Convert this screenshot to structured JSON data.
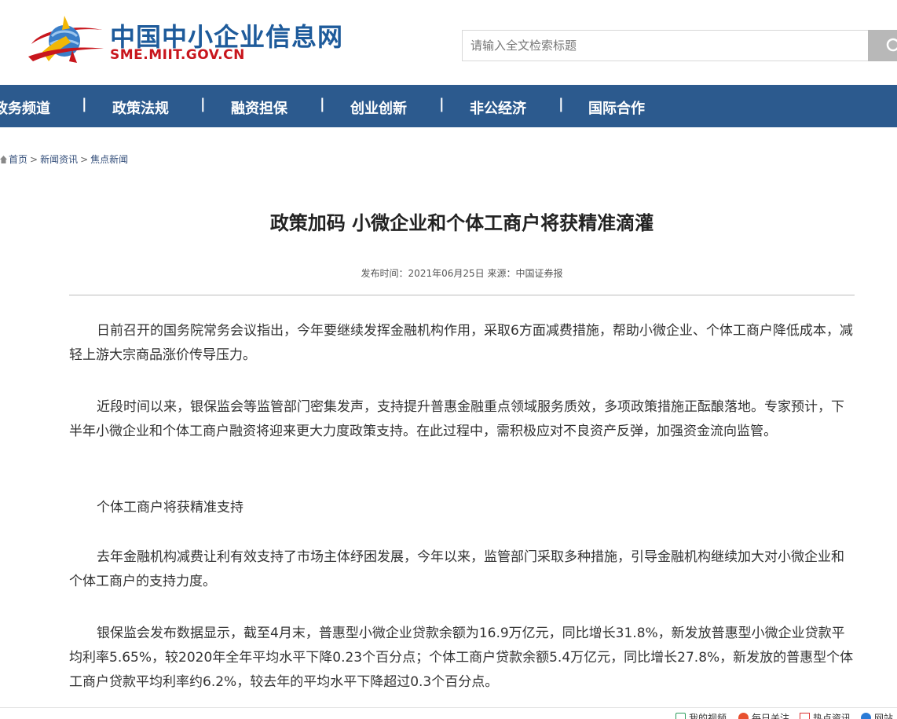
{
  "header": {
    "site_name": "中国中小企业信息网",
    "site_url": "SME.MIIT.GOV.CN",
    "search_placeholder": "请输入全文检索标题",
    "brand_blue": "#1e5b9b",
    "brand_red": "#c8161d"
  },
  "nav": {
    "background": "#2c5a8e",
    "items": [
      "政务频道",
      "政策法规",
      "融资担保",
      "创业创新",
      "非公经济",
      "国际合作"
    ],
    "separator": "|"
  },
  "breadcrumb": {
    "items": [
      "首页",
      "新闻资讯",
      "焦点新闻"
    ],
    "separator": ">"
  },
  "article": {
    "title": "政策加码 小微企业和个体工商户将获精准滴灌",
    "meta": "发布时间：2021年06月25日 来源：中国证券报",
    "paragraphs": [
      "日前召开的国务院常务会议指出，今年要继续发挥金融机构作用，采取6方面减费措施，帮助小微企业、个体工商户降低成本，减轻上游大宗商品涨价传导压力。",
      "近段时间以来，银保监会等监管部门密集发声，支持提升普惠金融重点领域服务质效，多项政策措施正酝酿落地。专家预计，下半年小微企业和个体工商户融资将迎来更大力度政策支持。在此过程中，需积极应对不良资产反弹，加强资金流向监管。",
      "个体工商户将获精准支持",
      "去年金融机构减费让利有效支持了市场主体纾困发展，今年以来，监管部门采取多种措施，引导金融机构继续加大对小微企业和个体工商户的支持力度。",
      "银保监会发布数据显示，截至4月末，普惠型小微企业贷款余额为16.9万亿元，同比增长31.8%，新发放普惠型小微企业贷款平均利率5.65%，较2020年全年平均水平下降0.23个百分点；个体工商户贷款余额5.4万亿元，同比增长27.8%，新发放的普惠型个体工商户贷款平均利率约6.2%，较去年的平均水平下降超过0.3个百分点。"
    ]
  },
  "bottom_bar": {
    "items": [
      "我的视频",
      "每日关注",
      "热点资讯",
      "网站"
    ]
  }
}
